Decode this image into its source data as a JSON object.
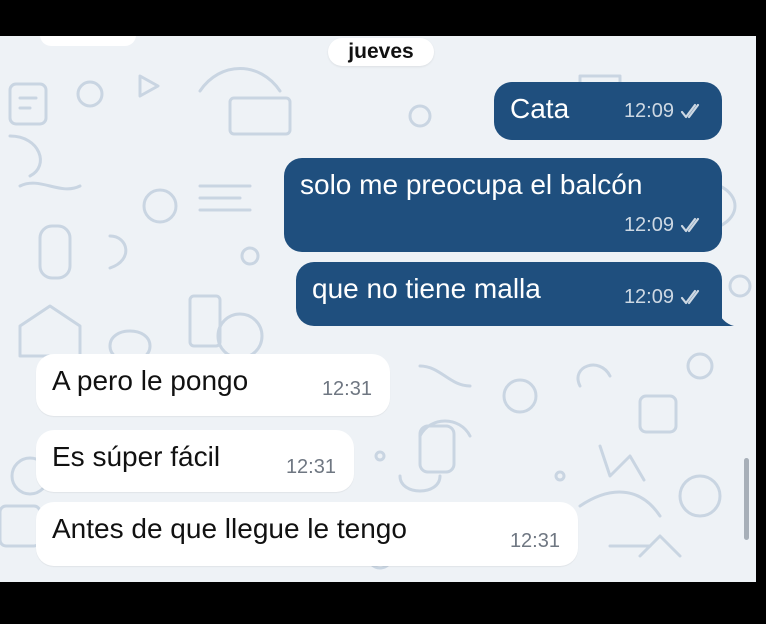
{
  "colors": {
    "outgoing_bubble": "#1f4f7e",
    "incoming_bubble": "#ffffff",
    "wallpaper": "#eef2f6",
    "doodle": "#c9d5e2"
  },
  "chat": {
    "date_separator": "jueves",
    "messages": [
      {
        "direction": "out",
        "text": "Cata",
        "time": "12:09",
        "status_icon": "double-check-icon"
      },
      {
        "direction": "out",
        "text": "solo me preocupa el balcón",
        "time": "12:09",
        "status_icon": "double-check-icon"
      },
      {
        "direction": "out",
        "text": "que no tiene malla",
        "time": "12:09",
        "status_icon": "double-check-icon"
      },
      {
        "direction": "in",
        "text": "A pero le pongo",
        "time": "12:31"
      },
      {
        "direction": "in",
        "text": "Es súper fácil",
        "time": "12:31"
      },
      {
        "direction": "in",
        "text": "Antes de que llegue le tengo",
        "time": "12:31"
      }
    ]
  }
}
